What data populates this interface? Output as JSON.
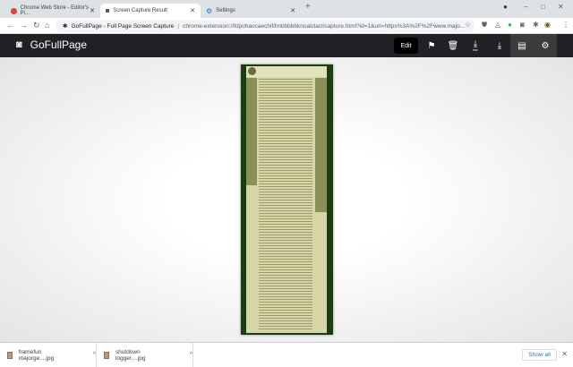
{
  "browser": {
    "tabs": [
      {
        "title": "Chrome Web Store - Editor's Pi...",
        "icon": "chrome-web-store-icon",
        "active": false
      },
      {
        "title": "Screen Capture Result",
        "icon": "camera-icon",
        "active": true
      },
      {
        "title": "Settings",
        "icon": "gear-icon",
        "active": false
      }
    ],
    "new_tab": "+",
    "url_site": "GoFullPage - Full Page Screen Capture",
    "url_path": "chrome-extension://fdpohaocaechififmbbbbbknoalclacl/capture.html?id=1&url=https%3A%2F%2Fwww.majo..."
  },
  "app": {
    "title": "GoFullPage",
    "edit_label": "Edit",
    "toolbar_icons": [
      "flag-icon",
      "trash-icon",
      "download-pdf-icon",
      "download-icon",
      "file-list-icon",
      "gear-icon"
    ],
    "pdf_label": "PDF"
  },
  "downloads": {
    "items": [
      {
        "name": "framefun majorge....jpg"
      },
      {
        "name": "shutdown logger....jpg"
      }
    ],
    "show_all": "Show all"
  },
  "colors": {
    "appbar": "#202124",
    "capture_border": "#1b3d12",
    "capture_page": "#d6d6a6",
    "link": "#1a73e8"
  }
}
